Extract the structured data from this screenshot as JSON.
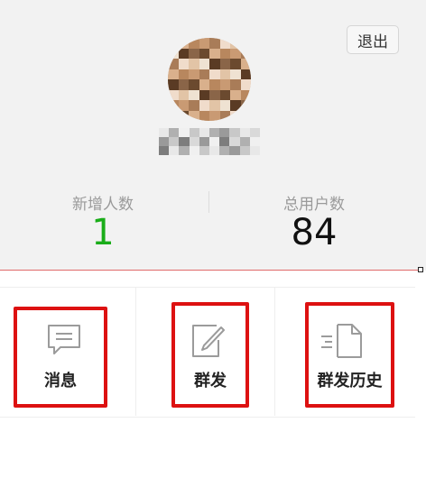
{
  "header": {
    "logout_label": "退出",
    "avatar": "avatar-pixelated",
    "username": "username-pixelated"
  },
  "stats": {
    "new_users": {
      "label": "新增人数",
      "value": "1",
      "color": "#1aad19"
    },
    "total_users": {
      "label": "总用户数",
      "value": "84",
      "color": "#111111"
    }
  },
  "menu": {
    "items": [
      {
        "label": "消息",
        "icon": "message-icon"
      },
      {
        "label": "群发",
        "icon": "compose-icon"
      },
      {
        "label": "群发历史",
        "icon": "document-history-icon"
      }
    ]
  },
  "colors": {
    "highlight": "#dd1111",
    "header_bg": "#f2f2f2",
    "accent_green": "#1aad19"
  }
}
